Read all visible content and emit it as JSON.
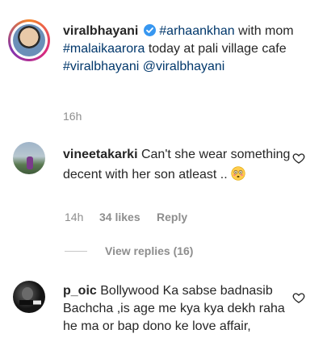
{
  "post": {
    "username": "viralbhayani",
    "verified_icon": "verified-badge-icon",
    "caption_parts": [
      {
        "text": " ",
        "type": "plain"
      },
      {
        "text": "#arhaankhan",
        "type": "link"
      },
      {
        "text": " with mom ",
        "type": "plain"
      },
      {
        "text": "#malaikaarora",
        "type": "link"
      },
      {
        "text": " today at pali village cafe ",
        "type": "plain"
      },
      {
        "text": "#viralbhayani",
        "type": "link"
      },
      {
        "text": " ",
        "type": "plain"
      },
      {
        "text": "@viralbhayani",
        "type": "link"
      }
    ],
    "time": "16h"
  },
  "comments": [
    {
      "username": "vineetakarki",
      "text": "Can't she wear something decent with her son atleast ..",
      "emoji": "flushed-face-emoji",
      "time": "14h",
      "likes": "34 likes",
      "reply_label": "Reply",
      "view_replies": "View replies (16)"
    },
    {
      "username": "p_oic",
      "text": "Bollywood Ka sabse badnasib Bachcha ,is age me kya kya dekh raha he ma or bap dono ke love affair,"
    }
  ],
  "colors": {
    "text": "#262626",
    "link": "#00376b",
    "muted": "#8e8e8e",
    "verified": "#3897f0",
    "story_ring_start": "#f58529",
    "story_ring_end": "#dd2a7b"
  }
}
